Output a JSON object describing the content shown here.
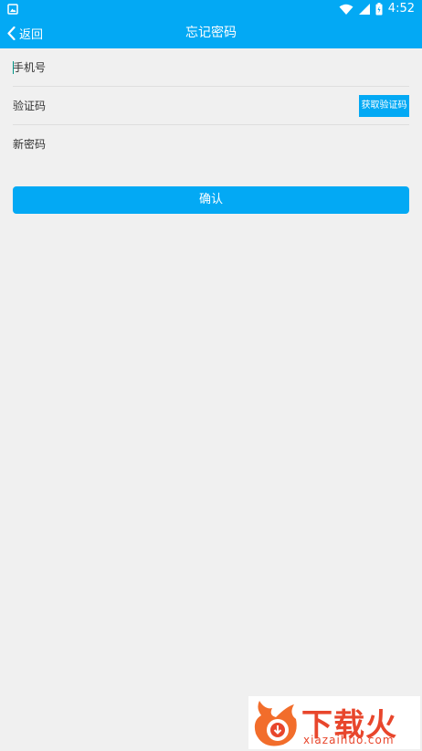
{
  "status_bar": {
    "time": "4:52"
  },
  "app_bar": {
    "back_label": "返回",
    "title": "忘记密码"
  },
  "form": {
    "phone_placeholder": "手机号",
    "code_placeholder": "验证码",
    "get_code_label": "获取验证码",
    "new_password_placeholder": "新密码"
  },
  "confirm_label": "确认",
  "watermark": {
    "brand": "下载火",
    "domain": "xiazaihuo.com"
  },
  "colors": {
    "accent": "#03a9f4",
    "background": "#f0f0f0",
    "watermark": "#e8462c"
  }
}
